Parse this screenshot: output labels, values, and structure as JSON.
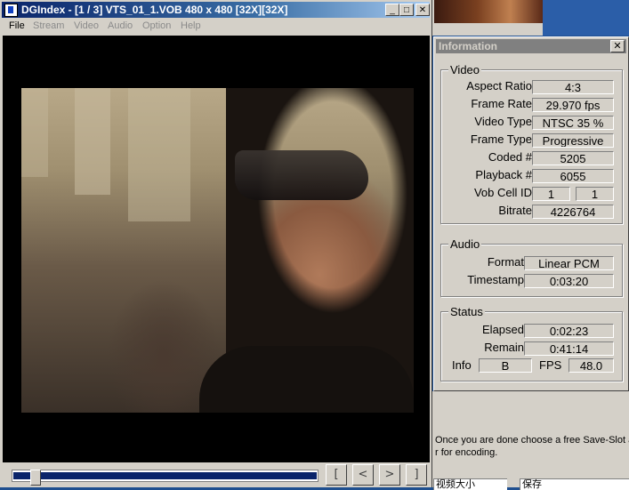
{
  "background": {
    "message_line1": "Once you are done choose a free Save-Slot at",
    "message_line2": "r for encoding.",
    "field1": "视频大小",
    "field2": "保存"
  },
  "main_window": {
    "title": "DGIndex - [1 / 3] VTS_01_1.VOB 480 x 480 [32X][32X]",
    "menu": [
      "File",
      "Stream",
      "Video",
      "Audio",
      "Option",
      "Help"
    ],
    "seek_position": 0.06,
    "nav_buttons": [
      "[",
      "<",
      ">",
      "]"
    ]
  },
  "info_window": {
    "title": "Information",
    "video": {
      "heading": "Video",
      "rows": [
        {
          "label": "Aspect Ratio",
          "value": "4:3"
        },
        {
          "label": "Frame Rate",
          "value": "29.970 fps"
        },
        {
          "label": "Video Type",
          "value": "NTSC 35 %"
        },
        {
          "label": "Frame Type",
          "value": "Progressive"
        },
        {
          "label": "Coded #",
          "value": "5205"
        },
        {
          "label": "Playback #",
          "value": "6055"
        }
      ],
      "vob_cell_label": "Vob Cell ID",
      "vob_id": "1",
      "cell_id": "1",
      "bitrate_label": "Bitrate",
      "bitrate": "4226764"
    },
    "audio": {
      "heading": "Audio",
      "format_label": "Format",
      "format": "Linear PCM",
      "timestamp_label": "Timestamp",
      "timestamp": "0:03:20"
    },
    "status": {
      "heading": "Status",
      "elapsed_label": "Elapsed",
      "elapsed": "0:02:23",
      "remain_label": "Remain",
      "remain": "0:41:14",
      "info_label": "Info",
      "info": "B",
      "fps_label": "FPS",
      "fps": "48.0"
    }
  }
}
